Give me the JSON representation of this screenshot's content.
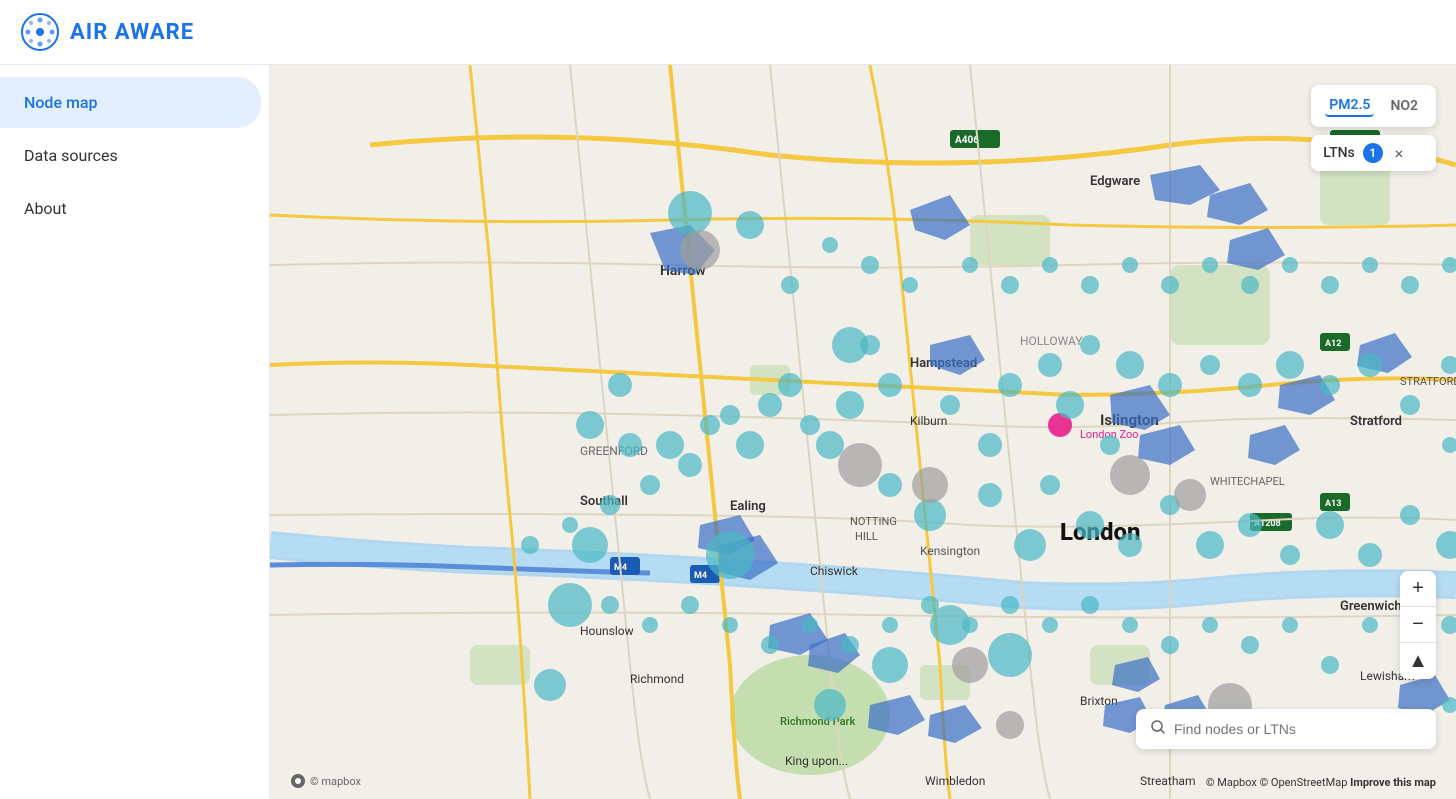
{
  "header": {
    "logo_text": "AIR AWARE",
    "logo_icon_alt": "air-aware-logo"
  },
  "sidebar": {
    "items": [
      {
        "id": "node-map",
        "label": "Node map",
        "active": true
      },
      {
        "id": "data-sources",
        "label": "Data sources",
        "active": false
      },
      {
        "id": "about",
        "label": "About",
        "active": false
      }
    ]
  },
  "map": {
    "controls": {
      "pollution_types": [
        {
          "id": "pm25",
          "label": "PM2.5",
          "active": true
        },
        {
          "id": "no2",
          "label": "NO2",
          "active": false
        }
      ],
      "ltn_filter": {
        "label": "LTNs",
        "count": "1",
        "close_symbol": "×"
      },
      "zoom_in_label": "+",
      "zoom_out_label": "−",
      "compass_label": "▲",
      "search_placeholder": "Find nodes or LTNs"
    },
    "attribution": {
      "mapbox": "© Mapbox",
      "osm": "© OpenStreetMap",
      "improve": "Improve this map"
    },
    "mapbox_logo": "© mapbox"
  }
}
